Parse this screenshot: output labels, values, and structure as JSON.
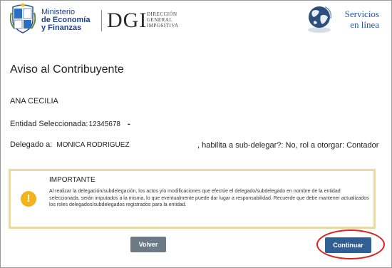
{
  "header": {
    "ministry_line1": "Ministerio",
    "ministry_line2": "de Economía",
    "ministry_line3": "y Finanzas",
    "dgi": "DGI",
    "dgi_sub1": "DIRECCIÓN",
    "dgi_sub2": "GENERAL",
    "dgi_sub3": "IMPOSITIVA",
    "servicios_line1": "Servicios",
    "servicios_line2": "en línea"
  },
  "main": {
    "title": "Aviso al Contribuyente",
    "name": "ANA CECILIA",
    "entidad_label": "Entidad Seleccionada:",
    "entidad_value": "12345678",
    "entidad_dash": "-",
    "delegado_label": "Delegado a:",
    "delegado_value": "MONICA RODRIGUEZ",
    "habilita_text": ", habilita a sub-delegar?: No, rol a otorgar: Contador"
  },
  "notice": {
    "title": "IMPORTANTE",
    "text": "Al realizar la delegación/subdelegación, los actos y/o modificaciones que efectúe el delegado/subdelegado en nombre de la entidad seleccionada, serán imputados a la misma, lo que eventualmente puede dar lugar a responsabilidad. Recuerde que debe mantener actualizados los roles delegados/subdelegados registrados para la entidad.",
    "icon": "exclamation-icon"
  },
  "buttons": {
    "volver": "Volver",
    "continuar": "Continuar"
  },
  "colors": {
    "brand_blue": "#1d3f8a",
    "continue_button": "#2f5f94",
    "back_button": "#6c7a86",
    "notice_border": "#e8d9a6",
    "highlight_circle": "#e02020"
  }
}
